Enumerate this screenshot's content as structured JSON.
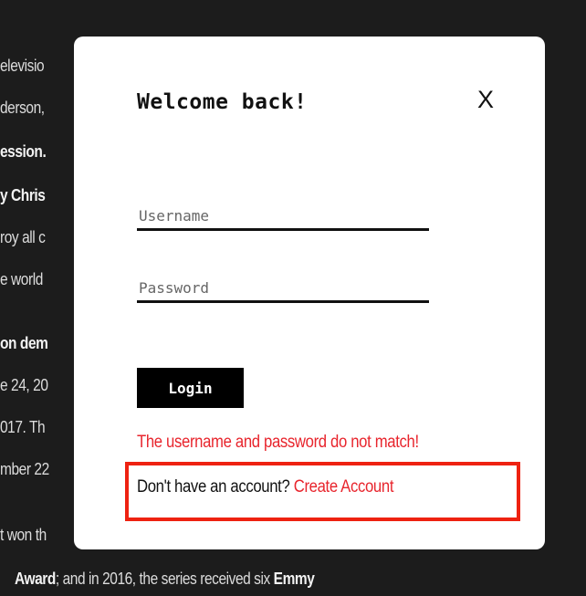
{
  "background": {
    "lines": [
      {
        "text": "elevisio",
        "bold": false
      },
      {
        "text": "derson,",
        "bold": false
      },
      {
        "text": "ession.",
        "bold": true
      },
      {
        "text": "y Chris",
        "bold": true
      },
      {
        "text": "roy all c",
        "bold": false
      },
      {
        "text": "e world",
        "bold": false
      },
      {
        "text": "on dem",
        "bold": true
      },
      {
        "text": "e 24, 20",
        "bold": false
      },
      {
        "text": "017. Th",
        "bold": false
      },
      {
        "text": "mber 22",
        "bold": false
      },
      {
        "text": "t won th",
        "bold": false
      }
    ],
    "bottom_line": {
      "part1": "Award",
      "part2": "; and in 2016, the series received six ",
      "part3": "Emmy"
    }
  },
  "modal": {
    "title": "Welcome back!",
    "close_label": "X",
    "username_placeholder": "Username",
    "password_placeholder": "Password",
    "login_label": "Login",
    "error_message": "The username and password do not match!",
    "signup_prompt": "Don't have an account?",
    "signup_link": "Create Account"
  },
  "colors": {
    "backdrop": "#1c1c1c",
    "modal_bg": "#ffffff",
    "error": "#e8252d",
    "highlight_border": "#ee2211",
    "button_bg": "#000000"
  }
}
